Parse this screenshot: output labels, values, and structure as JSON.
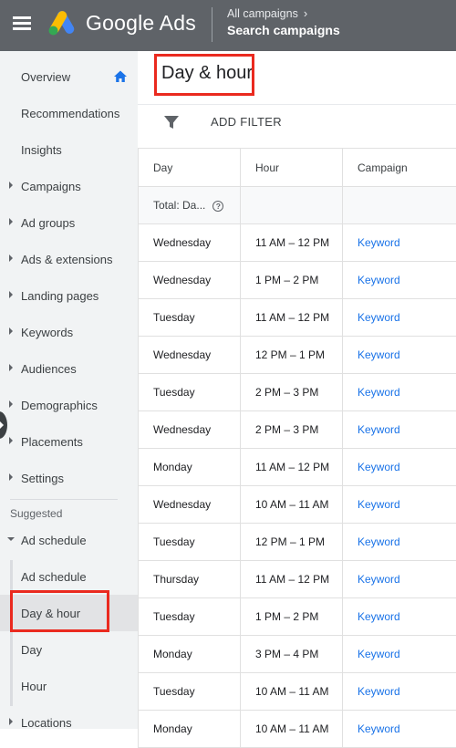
{
  "header": {
    "app_name": "Google Ads",
    "breadcrumb_parent": "All campaigns",
    "breadcrumb_current": "Search campaigns"
  },
  "sidebar": {
    "items": [
      {
        "label": "Overview"
      },
      {
        "label": "Recommendations"
      },
      {
        "label": "Insights"
      },
      {
        "label": "Campaigns"
      },
      {
        "label": "Ad groups"
      },
      {
        "label": "Ads & extensions"
      },
      {
        "label": "Landing pages"
      },
      {
        "label": "Keywords"
      },
      {
        "label": "Audiences"
      },
      {
        "label": "Demographics"
      },
      {
        "label": "Placements"
      },
      {
        "label": "Settings"
      }
    ],
    "suggested_label": "Suggested",
    "ad_schedule": {
      "label": "Ad schedule",
      "children": [
        {
          "label": "Ad schedule"
        },
        {
          "label": "Day & hour"
        },
        {
          "label": "Day"
        },
        {
          "label": "Hour"
        }
      ]
    },
    "locations_label": "Locations"
  },
  "main": {
    "title": "Day & hour",
    "filter_label": "ADD FILTER",
    "table": {
      "columns": [
        "Day",
        "Hour",
        "Campaign"
      ],
      "total_label": "Total: Da...",
      "rows": [
        {
          "day": "Wednesday",
          "hour": "11 AM – 12 PM",
          "campaign": "Keyword"
        },
        {
          "day": "Wednesday",
          "hour": "1 PM – 2 PM",
          "campaign": "Keyword"
        },
        {
          "day": "Tuesday",
          "hour": "11 AM – 12 PM",
          "campaign": "Keyword"
        },
        {
          "day": "Wednesday",
          "hour": "12 PM – 1 PM",
          "campaign": "Keyword"
        },
        {
          "day": "Tuesday",
          "hour": "2 PM – 3 PM",
          "campaign": "Keyword"
        },
        {
          "day": "Wednesday",
          "hour": "2 PM – 3 PM",
          "campaign": "Keyword"
        },
        {
          "day": "Monday",
          "hour": "11 AM – 12 PM",
          "campaign": "Keyword"
        },
        {
          "day": "Wednesday",
          "hour": "10 AM – 11 AM",
          "campaign": "Keyword"
        },
        {
          "day": "Tuesday",
          "hour": "12 PM – 1 PM",
          "campaign": "Keyword"
        },
        {
          "day": "Thursday",
          "hour": "11 AM – 12 PM",
          "campaign": "Keyword"
        },
        {
          "day": "Tuesday",
          "hour": "1 PM – 2 PM",
          "campaign": "Keyword"
        },
        {
          "day": "Monday",
          "hour": "3 PM – 4 PM",
          "campaign": "Keyword"
        },
        {
          "day": "Tuesday",
          "hour": "10 AM – 11 AM",
          "campaign": "Keyword"
        },
        {
          "day": "Monday",
          "hour": "10 AM – 11 AM",
          "campaign": "Keyword"
        }
      ]
    }
  },
  "colors": {
    "header_bg": "#5f6368",
    "sidebar_bg": "#f1f3f4",
    "link": "#1a73e8",
    "highlight": "#ea2a1f"
  }
}
